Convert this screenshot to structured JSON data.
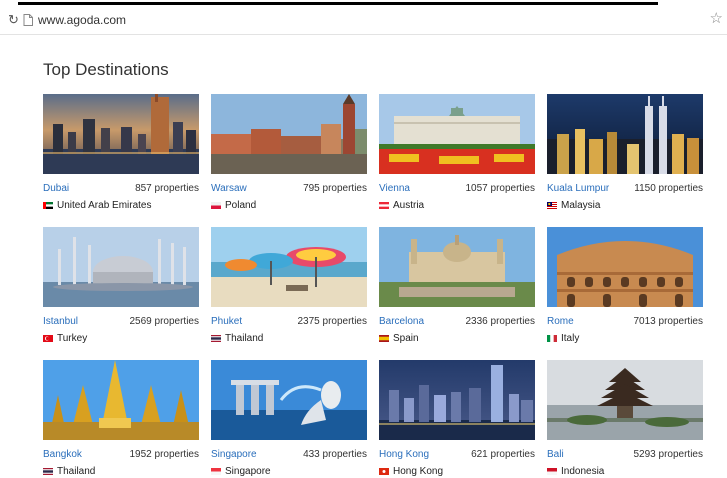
{
  "browser": {
    "url": "www.agoda.com"
  },
  "section": {
    "title": "Top Destinations"
  },
  "destinations": [
    {
      "city": "Dubai",
      "properties": "857 properties",
      "country": "United Arab Emirates"
    },
    {
      "city": "Warsaw",
      "properties": "795 properties",
      "country": "Poland"
    },
    {
      "city": "Vienna",
      "properties": "1057 properties",
      "country": "Austria"
    },
    {
      "city": "Kuala Lumpur",
      "properties": "1150 properties",
      "country": "Malaysia"
    },
    {
      "city": "Istanbul",
      "properties": "2569 properties",
      "country": "Turkey"
    },
    {
      "city": "Phuket",
      "properties": "2375 properties",
      "country": "Thailand"
    },
    {
      "city": "Barcelona",
      "properties": "2336 properties",
      "country": "Spain"
    },
    {
      "city": "Rome",
      "properties": "7013 properties",
      "country": "Italy"
    },
    {
      "city": "Bangkok",
      "properties": "1952 properties",
      "country": "Thailand"
    },
    {
      "city": "Singapore",
      "properties": "433 properties",
      "country": "Singapore"
    },
    {
      "city": "Hong Kong",
      "properties": "621 properties",
      "country": "Hong Kong"
    },
    {
      "city": "Bali",
      "properties": "5293 properties",
      "country": "Indonesia"
    }
  ],
  "colors": {
    "link": "#2a6ebb",
    "text": "#333333"
  }
}
